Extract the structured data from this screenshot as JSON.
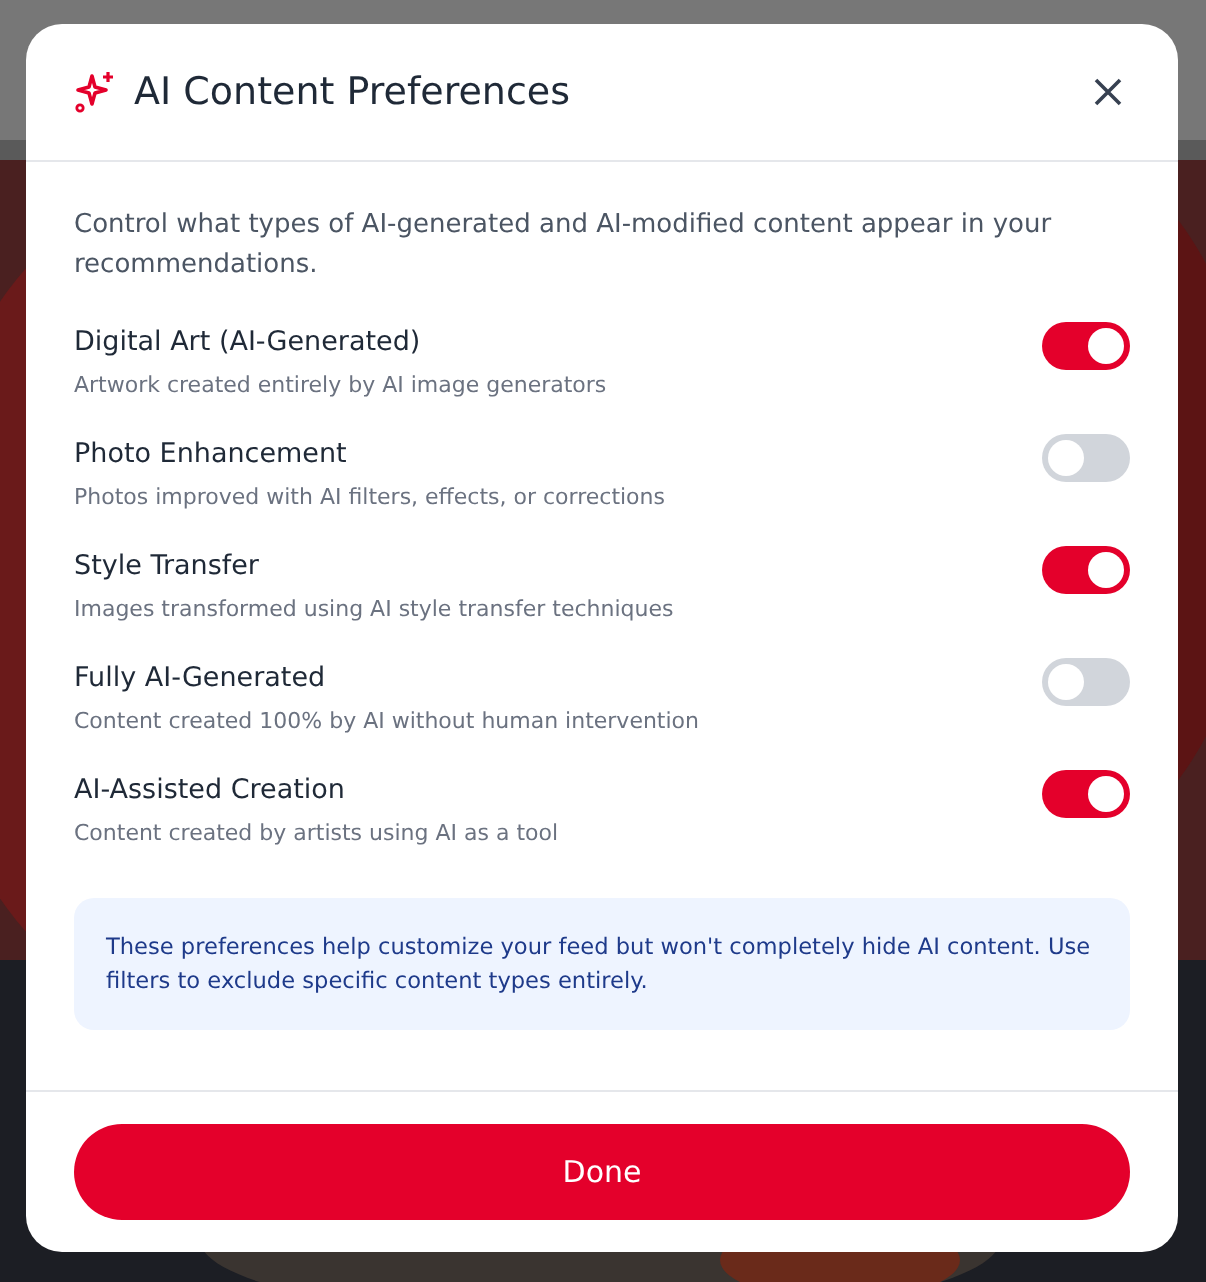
{
  "dialog": {
    "title": "AI Content Preferences",
    "description": "Control what types of AI-generated and AI-modified content appear in your recommendations.",
    "options": [
      {
        "label": "Digital Art (AI-Generated)",
        "hint": "Artwork created entirely by AI image generators",
        "on": true
      },
      {
        "label": "Photo Enhancement",
        "hint": "Photos improved with AI filters, effects, or corrections",
        "on": false
      },
      {
        "label": "Style Transfer",
        "hint": "Images transformed using AI style transfer techniques",
        "on": true
      },
      {
        "label": "Fully AI-Generated",
        "hint": "Content created 100% by AI without human intervention",
        "on": false
      },
      {
        "label": "AI-Assisted Creation",
        "hint": "Content created by artists using AI as a tool",
        "on": true
      }
    ],
    "note": "These preferences help customize your feed but won't completely hide AI content. Use filters to exclude specific content types entirely.",
    "button": "Done"
  }
}
